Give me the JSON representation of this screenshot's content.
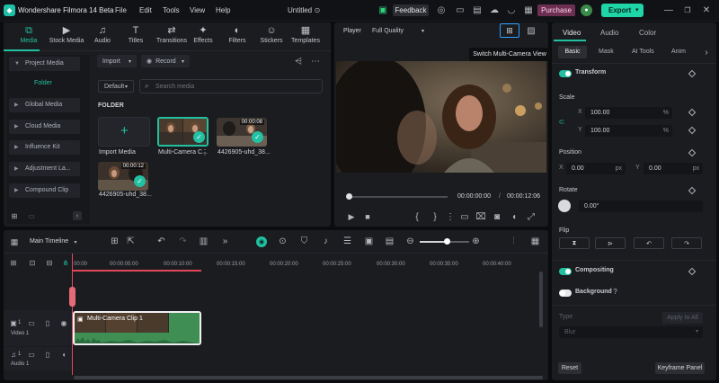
{
  "titlebar": {
    "app_name": "Wondershare Filmora 14 Beta",
    "menus": [
      "File",
      "Edit",
      "Tools",
      "View",
      "Help"
    ],
    "project_name": "Untitled",
    "feedback": "Feedback",
    "purchase": "Purchase",
    "export": "Export"
  },
  "toolbar": {
    "tabs": [
      {
        "label": "Media",
        "icon": "media-icon"
      },
      {
        "label": "Stock Media",
        "icon": "stock-media-icon"
      },
      {
        "label": "Audio",
        "icon": "music-icon"
      },
      {
        "label": "Titles",
        "icon": "titles-icon"
      },
      {
        "label": "Transitions",
        "icon": "transitions-icon"
      },
      {
        "label": "Effects",
        "icon": "effects-icon"
      },
      {
        "label": "Filters",
        "icon": "filters-icon"
      },
      {
        "label": "Stickers",
        "icon": "stickers-icon"
      },
      {
        "label": "Templates",
        "icon": "templates-icon"
      }
    ],
    "active_tab": "Media"
  },
  "sidebar": {
    "items": [
      "Project Media",
      "Folder",
      "Global Media",
      "Cloud Media",
      "Influence Kit",
      "Adjustment La...",
      "Compound Clip"
    ]
  },
  "media": {
    "import_btn": "Import",
    "record_btn": "Record",
    "sort": "Default",
    "search_placeholder": "Search media",
    "folder_heading": "FOLDER",
    "items": [
      {
        "name": "Import Media"
      },
      {
        "name": "Multi-Camera C...",
        "duration": ""
      },
      {
        "name": "4426905-uhd_38...",
        "duration": "00:00:08"
      },
      {
        "name": "4426905-uhd_38...",
        "duration": "00:00:12"
      }
    ]
  },
  "player": {
    "label": "Player",
    "quality": "Full Quality",
    "tooltip": "Switch Multi-Camera View",
    "current_time": "00:00:00:00",
    "separator": "/",
    "total_time": "00:00:12:06"
  },
  "timeline": {
    "name": "Main Timeline",
    "ruler": [
      "00:00",
      "00:00:05:00",
      "00:00:10:00",
      "00:00:15:00",
      "00:00:20:00",
      "00:00:25:00",
      "00:00:30:00",
      "00:00:35:00",
      "00:00:40:00"
    ],
    "clip_name": "Multi-Camera Clip 1",
    "video_track": "Video 1",
    "audio_track": "Audio 1",
    "video_track_num": "1",
    "audio_track_num": "1"
  },
  "props": {
    "tabs": [
      "Video",
      "Audio",
      "Color"
    ],
    "subtabs": [
      "Basic",
      "Mask",
      "AI Tools",
      "Anim"
    ],
    "transform": "Transform",
    "scale": "Scale",
    "scale_x_label": "X",
    "scale_x": "100.00",
    "scale_y_label": "Y",
    "scale_y": "100.00",
    "percent": "%",
    "position": "Position",
    "pos_x_label": "X",
    "pos_x": "0.00",
    "pos_y_label": "Y",
    "pos_y": "0.00",
    "px": "px",
    "rotate": "Rotate",
    "rotate_value": "0.00°",
    "flip": "Flip",
    "compositing": "Compositing",
    "background": "Background",
    "type": "Type",
    "apply_all": "Apply to All",
    "blur": "Blur",
    "reset": "Reset",
    "keyframe_panel": "Keyframe Panel"
  },
  "colors": {
    "accent": "#21c0a0",
    "purchase": "#6c2f52",
    "export": "#1fd4a7"
  }
}
